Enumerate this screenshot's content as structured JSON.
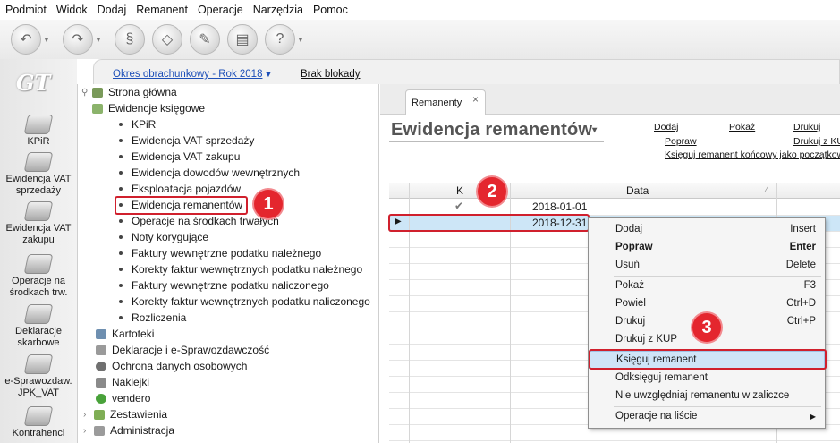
{
  "menu": [
    "Podmiot",
    "Widok",
    "Dodaj",
    "Remanent",
    "Operacje",
    "Narzędzia",
    "Pomoc"
  ],
  "toolbar_icons": [
    "back-icon",
    "forward-icon",
    "shell-icon",
    "eraser-icon",
    "broom-icon",
    "printer-icon",
    "help-icon"
  ],
  "logo_text": "GT",
  "leftbar": [
    {
      "label": "KPiR",
      "icon": "kpir-icon"
    },
    {
      "label": "Ewidencja VAT sprzedaży",
      "icon": "vat-sale-icon"
    },
    {
      "label": "Ewidencja VAT zakupu",
      "icon": "vat-purchase-icon"
    },
    {
      "label": "Operacje na środkach trw.",
      "icon": "assets-icon"
    },
    {
      "label": "Deklaracje skarbowe",
      "icon": "declarations-icon"
    },
    {
      "label": "e-Sprawozdaw. JPK_VAT",
      "icon": "jpk-icon"
    },
    {
      "label": "Kontrahenci",
      "icon": "contractors-icon"
    }
  ],
  "topstrip": {
    "period": "Okres obrachunkowy - Rok 2018",
    "period_caret": "▼",
    "blokady": "Brak blokady"
  },
  "tree": {
    "strona_glowna": "Strona główna",
    "ewidencje": "Ewidencje księgowe",
    "children": [
      "KPiR",
      "Ewidencja VAT sprzedaży",
      "Ewidencja VAT zakupu",
      "Ewidencja dowodów wewnętrznych",
      "Eksploatacja pojazdów",
      "Ewidencja remanentów",
      "Operacje na środkach trwałych",
      "Noty korygujące",
      "Faktury wewnętrzne podatku należnego",
      "Korekty faktur wewnętrznych podatku należnego",
      "Faktury wewnętrzne podatku naliczonego",
      "Korekty faktur wewnętrznych podatku naliczonego",
      "Rozliczenia"
    ],
    "bottom": [
      "Kartoteki",
      "Deklaracje i e-Sprawozdawczość",
      "Ochrona danych osobowych",
      "Naklejki",
      "vendero",
      "Zestawienia",
      "Administracja"
    ]
  },
  "badges": {
    "one": "1",
    "two": "2",
    "three": "3"
  },
  "tab": {
    "label": "Remanenty",
    "close": "×"
  },
  "content": {
    "title": "Ewidencja remanentów",
    "title_caret": "▾",
    "links": {
      "dodaj": "Dodaj",
      "pokaz": "Pokaż",
      "drukuj": "Drukuj",
      "popraw": "Popraw",
      "drukuj_kup": "Drukuj z KUP",
      "ksieguj": "Księguj remanent końcowy jako początkowy"
    }
  },
  "grid": {
    "col_k": "K",
    "col_data": "Data",
    "rows": [
      {
        "checked": "✔",
        "date": "2018-01-01"
      },
      {
        "marker": "▶",
        "date": "2018-12-31"
      }
    ]
  },
  "context_menu": {
    "dodaj": {
      "label": "Dodaj",
      "key": "Insert"
    },
    "popraw": {
      "label": "Popraw",
      "key": "Enter"
    },
    "usun": {
      "label": "Usuń",
      "key": "Delete"
    },
    "pokaz": {
      "label": "Pokaż",
      "key": "F3"
    },
    "powiel": {
      "label": "Powiel",
      "key": "Ctrl+D"
    },
    "drukuj": {
      "label": "Drukuj",
      "key": "Ctrl+P"
    },
    "drukuj_kup": {
      "label": "Drukuj z KUP"
    },
    "ksieguj": {
      "label": "Księguj remanent"
    },
    "odksieguj": {
      "label": "Odksięguj remanent"
    },
    "nie_uwzgl": {
      "label": "Nie uwzględniaj remanentu w zaliczce"
    },
    "operacje": {
      "label": "Operacje na liście",
      "arrow": "▶"
    }
  },
  "colors": {
    "highlight_red": "#d0202d",
    "badge_red": "#e4262e",
    "link_blue": "#1d4fb8",
    "selection": "#cde6f7"
  }
}
